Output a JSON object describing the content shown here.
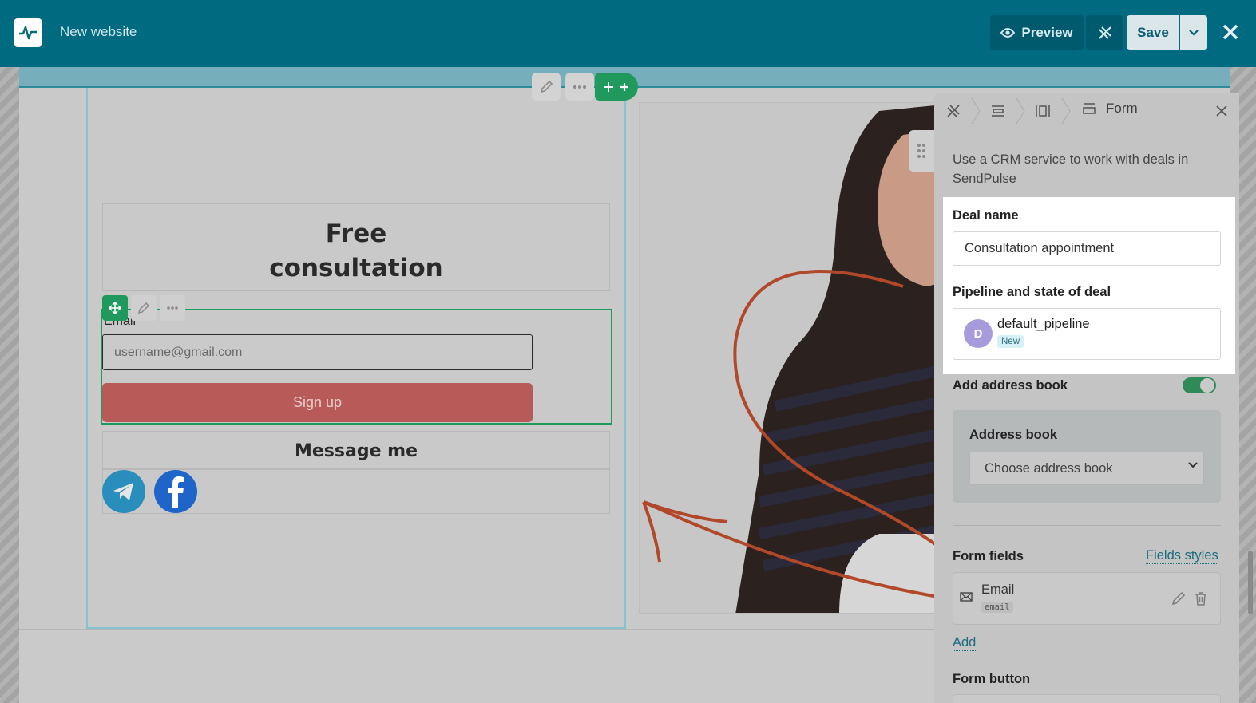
{
  "header": {
    "app_title": "New website",
    "preview_label": "Preview",
    "save_label": "Save"
  },
  "canvas": {
    "hero_title_line1": "Free",
    "hero_title_line2": "consultation",
    "email_label": "Email",
    "email_placeholder": "username@gmail.com",
    "signup_label": "Sign up",
    "message_title": "Message me",
    "social_icons": [
      "telegram-icon",
      "facebook-icon"
    ]
  },
  "panel": {
    "breadcrumb_current": "Form",
    "description": "Use a CRM service to work with deals in SendPulse",
    "deal_name_label": "Deal name",
    "deal_name_value": "Consultation appointment",
    "pipeline_label": "Pipeline and state of deal",
    "pipeline_avatar": "D",
    "pipeline_name": "default_pipeline",
    "pipeline_state": "New",
    "add_address_book_label": "Add address book",
    "add_address_book_enabled": true,
    "address_book_label": "Address book",
    "address_book_select": "Choose address book",
    "form_fields_label": "Form fields",
    "fields_styles_link": "Fields styles",
    "fields": [
      {
        "name": "Email",
        "key": "email"
      }
    ],
    "add_link": "Add",
    "form_button_label": "Form button"
  },
  "colors": {
    "header_bg": "#006a80",
    "accent_green": "#1f9a5c",
    "signup_red": "#b85a58",
    "link_blue": "#1e6c80",
    "avatar_purple": "#a79bdc"
  }
}
